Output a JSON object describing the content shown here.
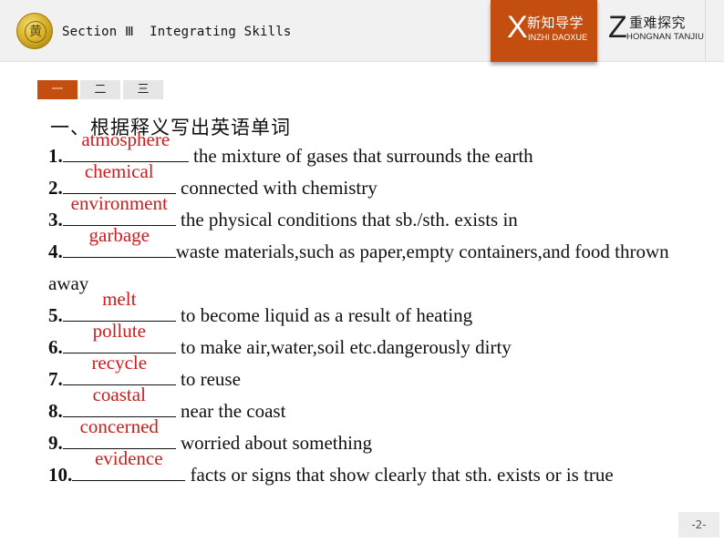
{
  "header": {
    "logo_icon": "school-emblem-icon",
    "logo_glyph": "黄",
    "section_title": "Section Ⅲ  Integrating Skills",
    "nav": [
      {
        "letter": "X",
        "label_cn": "新知导学",
        "label_pinyin": "INZHI DAOXUE",
        "active": true
      },
      {
        "letter": "Z",
        "label_cn": "重难探究",
        "label_pinyin": "HONGNAN TANJIU",
        "active": false
      }
    ]
  },
  "tabs": [
    {
      "label": "一",
      "active": true
    },
    {
      "label": "二",
      "active": false
    },
    {
      "label": "三",
      "active": false
    }
  ],
  "heading": "一、根据释义写出英语单词",
  "items": [
    {
      "num": "1",
      "answer": "atmosphere",
      "definition": " the mixture of gases that surrounds the earth"
    },
    {
      "num": "2",
      "answer": "chemical",
      "definition": " connected with chemistry"
    },
    {
      "num": "3",
      "answer": "environment",
      "definition": " the physical conditions that sb./sth. exists in"
    },
    {
      "num": "4",
      "answer": "garbage",
      "definition": "waste materials,such as paper,empty containers,and food thrown away"
    },
    {
      "num": "5",
      "answer": "melt",
      "definition": " to become liquid as a result of heating"
    },
    {
      "num": "6",
      "answer": "pollute",
      "definition": " to make air,water,soil etc.dangerously dirty"
    },
    {
      "num": "7",
      "answer": "recycle",
      "definition": " to reuse"
    },
    {
      "num": "8",
      "answer": "coastal",
      "definition": " near the coast"
    },
    {
      "num": "9",
      "answer": "concerned",
      "definition": " worried about something"
    },
    {
      "num": "10",
      "answer": "evidence",
      "definition": " facts or signs that show clearly that sth. exists or is true"
    }
  ],
  "page_number": "-2-",
  "colors": {
    "accent": "#c44e0f",
    "answer": "#cc1d1d",
    "header_bg": "#f1f1f1"
  }
}
